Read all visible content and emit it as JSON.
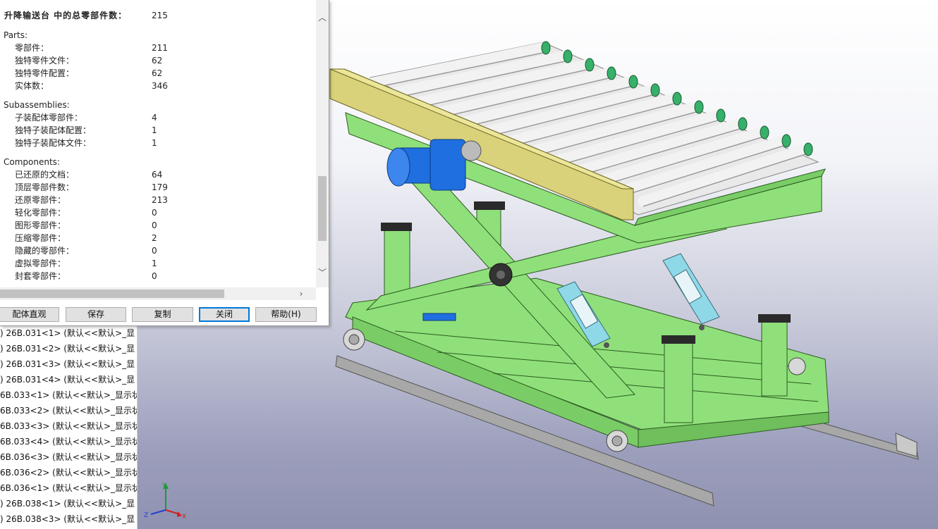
{
  "dialog": {
    "title_label": "升降输送台 中的总零部件数：",
    "title_value": "215",
    "sections": [
      {
        "heading": "Parts:",
        "rows": [
          {
            "label": "零部件：",
            "value": "211"
          },
          {
            "label": "独特零件文件：",
            "value": "62"
          },
          {
            "label": "独特零件配置：",
            "value": "62"
          },
          {
            "label": "实体数：",
            "value": "346"
          }
        ]
      },
      {
        "heading": "Subassemblies:",
        "rows": [
          {
            "label": "子装配体零部件：",
            "value": "4"
          },
          {
            "label": "独特子装配体配置：",
            "value": "1"
          },
          {
            "label": "独特子装配体文件：",
            "value": "1"
          }
        ]
      },
      {
        "heading": "Components:",
        "rows": [
          {
            "label": "已还原的文档：",
            "value": "64"
          },
          {
            "label": "顶层零部件数：",
            "value": "179"
          },
          {
            "label": "还原零部件：",
            "value": "213"
          },
          {
            "label": "轻化零部件：",
            "value": "0"
          },
          {
            "label": "图形零部件：",
            "value": "0"
          },
          {
            "label": "压缩零部件：",
            "value": "2"
          },
          {
            "label": "隐藏的零部件：",
            "value": "0"
          },
          {
            "label": "虚拟零部件：",
            "value": "1"
          },
          {
            "label": "封套零部件：",
            "value": "0"
          }
        ]
      }
    ],
    "buttons": {
      "assembly_visualization": "配体直观",
      "save": "保存",
      "copy": "复制",
      "close": "关闭",
      "help": "帮助(H)"
    }
  },
  "tree": {
    "items": [
      ") 26B.031<1> (默认<<默认>_显",
      ") 26B.031<2> (默认<<默认>_显",
      ") 26B.031<3> (默认<<默认>_显",
      ") 26B.031<4> (默认<<默认>_显",
      "6B.033<1> (默认<<默认>_显示状",
      "6B.033<2> (默认<<默认>_显示状",
      "6B.033<3> (默认<<默认>_显示状",
      "6B.033<4> (默认<<默认>_显示状",
      "6B.036<3> (默认<<默认>_显示状",
      "6B.036<2> (默认<<默认>_显示状",
      "6B.036<1> (默认<<默认>_显示状",
      ") 26B.038<1> (默认<<默认>_显",
      ") 26B.038<3> (默认<<默认>_显"
    ]
  },
  "triad": {
    "x": "X",
    "y": "Y",
    "z": "Z"
  },
  "colors": {
    "frame_green": "#8fe07a",
    "roller_white": "#f2f2f2",
    "roller_cap_green": "#37b06a",
    "beam_yellow": "#d9d27a",
    "motor_blue": "#1f6fe0",
    "cylinder_cyan": "#8fd8e8",
    "rail_gray": "#a8a8a8",
    "accent_blue": "#0078d7"
  }
}
